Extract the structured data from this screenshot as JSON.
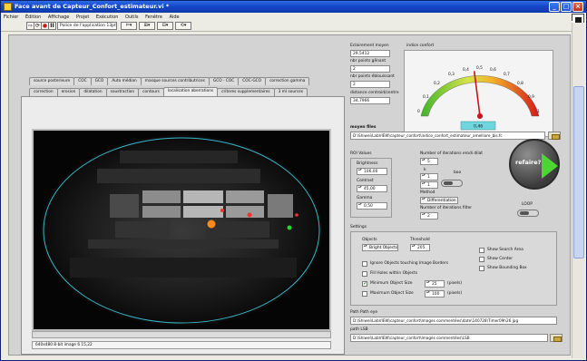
{
  "window": {
    "title": "Face avant de Capteur_Confort_estimateur.vi *",
    "minimize": "_",
    "maximize": "□",
    "close": "×"
  },
  "menu": [
    "Fichier",
    "Édition",
    "Affichage",
    "Projet",
    "Exécution",
    "Outils",
    "Fenêtre",
    "Aide"
  ],
  "toolbar": {
    "font": "Police de l'application 13pts",
    "run": "⇨",
    "continuous": "⟳",
    "abort": "●",
    "pause": "II"
  },
  "tabs_row1": [
    "source posterieure",
    "COC",
    "GCO",
    "Auto médian",
    "masque sources contributrices",
    "GCO - COC",
    "COC-GCO",
    "correction gamma"
  ],
  "tabs_row2": [
    "correction",
    "erosion",
    "dilatation",
    "soustraction",
    "contours",
    "localisation aberrations",
    "criteres supplementaires",
    "3 ml sources"
  ],
  "active_tab": "localisation aberrations",
  "image_info": "640x480 8-bit image 6    15,22",
  "stats": {
    "eclairement_label": "Eclairement moyen",
    "eclairement_value": "29,5412",
    "pts_genant_label": "nbr points gênant",
    "pts_genant_value": "2",
    "pts_eblouit_label": "nbr points éblouissant",
    "pts_eblouit_value": "2",
    "distance_label": "distance centroid/centre",
    "distance_value": "34,7966"
  },
  "gauge": {
    "label": "indice confort",
    "ticks": [
      "0",
      "0,1",
      "0,2",
      "0,3",
      "0,4",
      "0,5",
      "0,6",
      "0,7",
      "0,8",
      "0,9",
      "1"
    ],
    "value_text": "0,46",
    "value": 0.46
  },
  "moyen_file": {
    "label": "moyen files",
    "path": "D:\\Shiwei\\LabVIEW\\capteur_confort\\indice_confort_estimateur_amelliore_bis.fc"
  },
  "roi": {
    "label": "ROI Values",
    "brightness_label": "Brightness",
    "brightness": "106,00",
    "contrast_label": "Contrast",
    "contrast": "45,00",
    "gamma_label": "Gamma",
    "gamma": "0,50"
  },
  "iterations": {
    "erode_label": "Number of iterations erodi dilat",
    "erode_value": "5",
    "k_label": "k",
    "k_value": "1",
    "k2_value": "1",
    "boo_label": "boo",
    "method_label": "Method",
    "method_value": "Differentiation",
    "filter_label": "Number of iterations filter",
    "filter_value": "2"
  },
  "refaire": {
    "label": "refaire?",
    "loop_label": "LOOP"
  },
  "settings": {
    "label": "Settings",
    "objects_label": "Objects",
    "objects_value": "Bright Objects",
    "threshold_label": "Threshold",
    "threshold_value": "205",
    "ignore_border": "Ignore Objects touching Image Borders",
    "fill_holes": "Fill Holes within Objects",
    "min_size": "Minimum Object Size",
    "min_size_value": "25",
    "max_size": "Maximum Object Size",
    "max_size_value": "100",
    "pixels": "(pixels)",
    "show_search": "Show Search Area",
    "show_center": "Show Center",
    "show_bbox": "Show Bounding Box"
  },
  "path_paths": {
    "label": "Path Path eye",
    "value": "D:\\Shiwei\\LabVIEW\\capteur_confort\\Images commentées\\date\\140728\\Timer09h26.jpg"
  },
  "path_lsb": {
    "label": "path LSB",
    "value": "D:\\Shiwei\\LabVIEW\\capteur_confort\\Images commentées\\LSB"
  },
  "colors": {
    "title_bar": "#1447c8",
    "gauge_value": "#6fd6de",
    "play": "#4cd631",
    "ellipse": "#38b7c8"
  }
}
